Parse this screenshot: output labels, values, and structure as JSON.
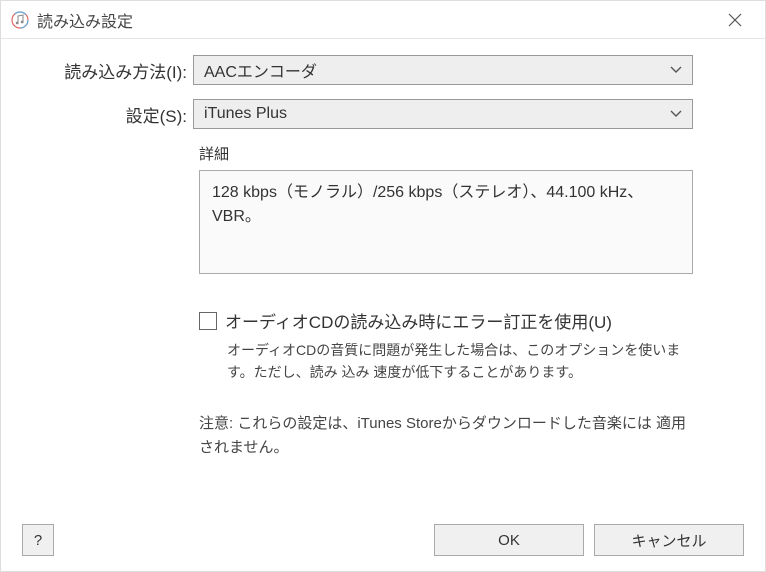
{
  "window": {
    "title": "読み込み設定"
  },
  "fields": {
    "import_method": {
      "label": "読み込み方法(I):",
      "value": "AACエンコーダ"
    },
    "setting": {
      "label": "設定(S):",
      "value": "iTunes Plus"
    }
  },
  "details": {
    "label": "詳細",
    "text": "128 kbps（モノラル）/256 kbps（ステレオ）、44.100 kHz、VBR。"
  },
  "error_correction": {
    "label": "オーディオCDの読み込み時にエラー訂正を使用(U)",
    "description": "オーディオCDの音質に問題が発生した場合は、このオプションを使います。ただし、読み 込み 速度が低下することがあります。"
  },
  "note": "注意: これらの設定は、iTunes Storeからダウンロードした音楽には 適用されません。",
  "buttons": {
    "help": "?",
    "ok": "OK",
    "cancel": "キャンセル"
  }
}
